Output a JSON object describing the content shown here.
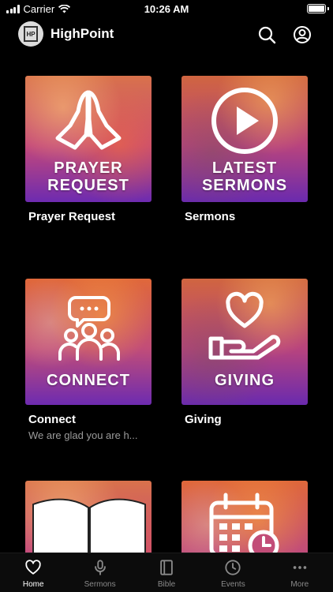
{
  "status_bar": {
    "carrier": "Carrier",
    "time": "10:26 AM"
  },
  "header": {
    "title": "HighPoint",
    "logo_text": "HP"
  },
  "cards": [
    {
      "tile_line1": "PRAYER",
      "tile_line2": "REQUEST",
      "title": "Prayer Request",
      "subtitle": ""
    },
    {
      "tile_line1": "LATEST",
      "tile_line2": "SERMONS",
      "title": "Sermons",
      "subtitle": ""
    },
    {
      "tile_line1": "",
      "tile_line2": "CONNECT",
      "title": "Connect",
      "subtitle": "We are glad you are h..."
    },
    {
      "tile_line1": "",
      "tile_line2": "GIVING",
      "title": "Giving",
      "subtitle": ""
    }
  ],
  "tab_bar": {
    "items": [
      {
        "label": "Home",
        "icon": "heart-icon"
      },
      {
        "label": "Sermons",
        "icon": "microphone-icon"
      },
      {
        "label": "Bible",
        "icon": "book-icon"
      },
      {
        "label": "Events",
        "icon": "clock-icon"
      },
      {
        "label": "More",
        "icon": "more-dots-icon"
      }
    ],
    "active_index": 0
  },
  "colors": {
    "background": "#000000",
    "tile_gradient_top": "#d9724b",
    "tile_gradient_bottom": "#6d2bb0",
    "muted_text": "#9b9b9b"
  }
}
